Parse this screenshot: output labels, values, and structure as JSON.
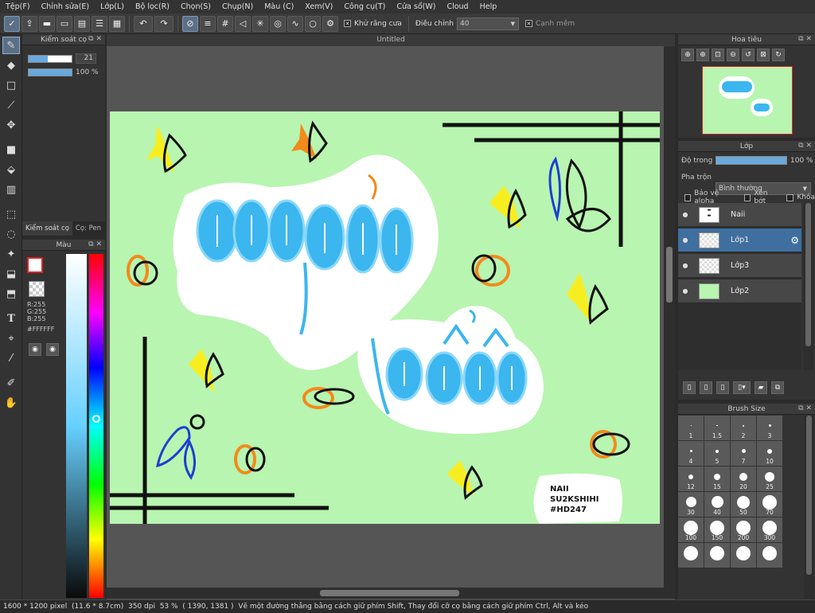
{
  "menu": [
    "Tệp(F)",
    "Chỉnh sửa(E)",
    "Lớp(L)",
    "Bộ lọc(R)",
    "Chọn(S)",
    "Chụp(N)",
    "Màu (C)",
    "Xem(V)",
    "Công cụ(T)",
    "Cửa sổ(W)",
    "Cloud",
    "Help"
  ],
  "toolbar": {
    "antialias_label": "Khử răng cưa",
    "adjust_label": "Điều chỉnh",
    "adjust_value": "40",
    "soft_edge_label": "Cạnh mềm"
  },
  "document": {
    "title": "Untitled"
  },
  "brush_control": {
    "title": "Kiểm soát cọ",
    "size_value": "21",
    "size_level": 0.45,
    "opacity_value": "100 %",
    "opacity_level": 1.0
  },
  "lower_tabs": [
    "Kiểm soát cọ",
    "Cọ: Pen"
  ],
  "color_panel": {
    "title": "Màu",
    "r": "R:255",
    "g": "G:255",
    "b": "B:255",
    "hex": "#FFFFFF"
  },
  "navigator": {
    "title": "Hoa tiêu"
  },
  "layers": {
    "title": "Lớp",
    "opacity_label": "Độ trong",
    "opacity_value": "100 %",
    "opacity_level": 1.0,
    "blend_label": "Pha trộn",
    "blend_value": "Bình thường",
    "protect_alpha": "Bảo vệ alpha",
    "clipping": "Xén bớt",
    "lock": "Khóa",
    "items": [
      {
        "name": "Naii",
        "selected": false
      },
      {
        "name": "Lớp1",
        "selected": true
      },
      {
        "name": "Lớp3",
        "selected": false
      },
      {
        "name": "Lớp2",
        "selected": false
      }
    ]
  },
  "brush_size": {
    "title": "Brush Size",
    "sizes": [
      "1",
      "1.5",
      "2",
      "3",
      "4",
      "5",
      "7",
      "10",
      "12",
      "15",
      "20",
      "25",
      "30",
      "40",
      "50",
      "70",
      "100",
      "150",
      "200",
      "300",
      "",
      "",
      "",
      ""
    ]
  },
  "artwork": {
    "signature_line1": "NAII",
    "signature_line2": "SU2KSHIHI",
    "signature_line3": "#HD247",
    "colors": {
      "background": "#b8f5b0",
      "blue": "#3bb6ef",
      "orange": "#f28a1c",
      "yellow": "#f7ee22",
      "black": "#111111"
    }
  },
  "status": {
    "dimensions": "1600 * 1200 pixel",
    "physical": "(11.6 * 8.7cm)",
    "dpi": "350 dpi",
    "zoom": "53 %",
    "coords": "( 1390, 1381 )",
    "hint": "Vẽ một đường thẳng bằng cách giữ phím Shift, Thay đổi cỡ cọ bằng cách giữ phím Ctrl, Alt và kéo"
  }
}
